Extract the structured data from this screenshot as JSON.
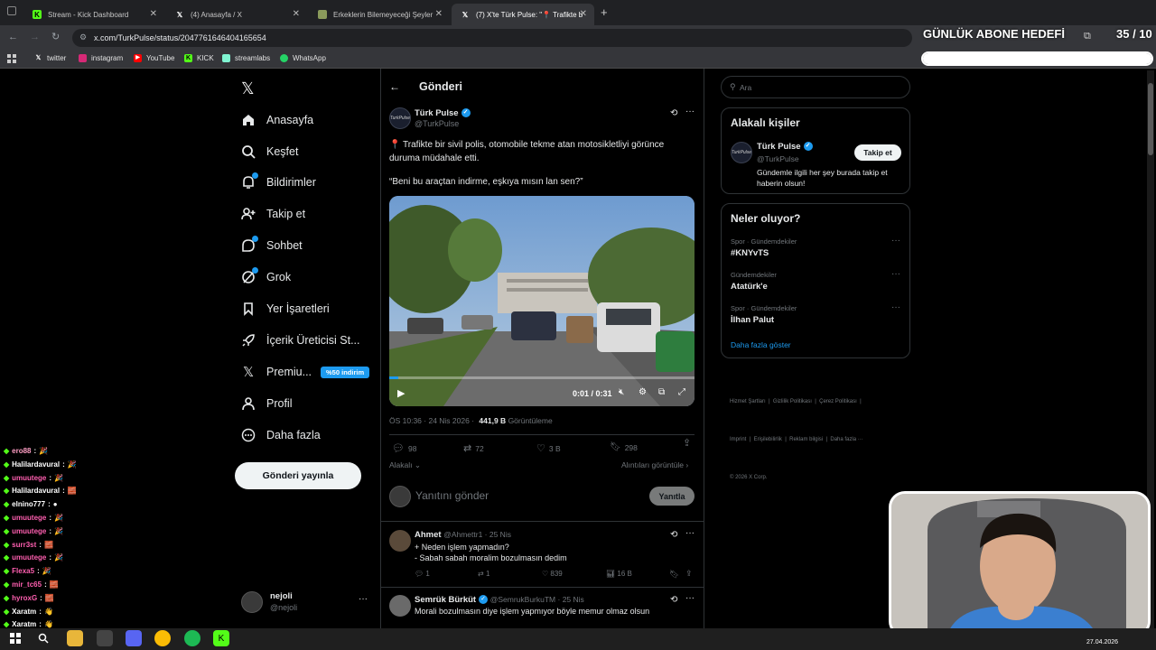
{
  "browser": {
    "tabs": [
      {
        "title": "Stream - Kick Dashboard",
        "icon": "kick-icon",
        "active": false
      },
      {
        "title": "(4) Anasayfa / X",
        "icon": "x-logo-icon",
        "active": false
      },
      {
        "title": "Erkeklerin Bilemeyeceği Şeyler",
        "icon": "generic-page-icon",
        "active": false
      },
      {
        "title": "(7) X'te Türk Pulse: \"📍 Trafikte b",
        "icon": "x-logo-icon",
        "active": true
      }
    ],
    "url": "x.com/TurkPulse/status/2047761646404165654",
    "bookmarks": [
      "twitter",
      "instagram",
      "YouTube",
      "KICK",
      "streamlabs",
      "WhatsApp"
    ]
  },
  "overlay": {
    "goal_label": "GÜNLÜK ABONE HEDEFİ",
    "goal_count": "35 / 10",
    "goal_progress": 1.0
  },
  "sidebar": {
    "items": [
      {
        "label": "Anasayfa",
        "icon": "home-icon"
      },
      {
        "label": "Keşfet",
        "icon": "search-icon"
      },
      {
        "label": "Bildirimler",
        "icon": "bell-icon"
      },
      {
        "label": "Takip et",
        "icon": "follow-icon"
      },
      {
        "label": "Sohbet",
        "icon": "chat-icon"
      },
      {
        "label": "Grok",
        "icon": "grok-icon"
      },
      {
        "label": "Yer İşaretleri",
        "icon": "bookmark-icon"
      },
      {
        "label": "İçerik Üreticisi St...",
        "icon": "rocket-icon"
      },
      {
        "label": "Premiu...",
        "icon": "x-logo-icon"
      },
      {
        "label": "Profil",
        "icon": "profile-icon"
      },
      {
        "label": "Daha fazla",
        "icon": "more-circle-icon"
      }
    ],
    "premium_badge": "%50 indirim",
    "post_button": "Gönderi yayınla",
    "account": {
      "name": "nejoli",
      "handle": "@nejoli"
    }
  },
  "main": {
    "header": "Gönderi",
    "post": {
      "author": "Türk Pulse",
      "handle": "@TurkPulse",
      "text_line1": "📍 Trafikte bir sivil polis, otomobile tekme atan motosikletliyi görünce",
      "text_line2": "duruma müdahale etti.",
      "quote": "“Beni bu araçtan indirme, eşkıya mısın lan sen?”",
      "video_time": "0:01 / 0:31",
      "video_progress": 0.03,
      "timestamp": "ÖS 10:36 · 24 Nis 2026 ·",
      "views": "441,9 B",
      "views_label": "Görüntüleme",
      "replies": "98",
      "reposts": "72",
      "likes": "3 B",
      "bookmarks": "298",
      "relevance": "Alakalı",
      "quotes_link": "Alıntıları görüntüle"
    },
    "reply_placeholder": "Yanıtını gönder",
    "reply_button": "Yanıtla",
    "replies": [
      {
        "name": "Ahmet",
        "handle": "@Ahmettr1 · 25 Nis",
        "line1": "+ Neden işlem yapmadın?",
        "line2": "- Sabah sabah moralim bozulmasın dedim",
        "replies": "1",
        "reposts": "1",
        "likes": "839",
        "views": "16 B"
      },
      {
        "name": "Semrük Bürküt",
        "handle": "@SemrukBurkuTM · 25 Nis",
        "line1": "Morali bozulmasın diye işlem yapmıyor böyle memur olmaz olsun"
      }
    ]
  },
  "right": {
    "search_placeholder": "Ara",
    "related_title": "Alakalı kişiler",
    "related": {
      "name": "Türk Pulse",
      "handle": "@TurkPulse",
      "bio1": "Gündemle ilgili her şey burada takip et",
      "bio2": "haberin olsun!",
      "follow": "Takip et"
    },
    "trends_title": "Neler oluyor?",
    "trends": [
      {
        "category": "Spor · Gündemdekiler",
        "name": "#KNYvTS"
      },
      {
        "category": "Gündemdekiler",
        "name": "Atatürk'e"
      },
      {
        "category": "Spor · Gündemdekiler",
        "name": "İlhan Palut"
      }
    ],
    "show_more": "Daha fazla göster",
    "footer_line1": "Hizmet Şartları  |  Gizlilik Politikası  |  Çerez Politikası  |",
    "footer_line2": "Imprint  |  Erişilebilirlik  |  Reklam bilgisi  |  Daha fazla ···",
    "footer_line3": "© 2026 X Corp."
  },
  "chat": [
    {
      "user": "ero88",
      "msg": "🎉",
      "color": "#ff9ec4"
    },
    {
      "user": "Halilardavural",
      "msg": "🎉",
      "color": "#ffffff"
    },
    {
      "user": "umuutege",
      "msg": "🎉",
      "color": "#ff5fb0"
    },
    {
      "user": "Halilardavural",
      "msg": "🧱",
      "color": "#ffffff"
    },
    {
      "user": "elnino777",
      "msg": "●",
      "color": "#ffffff"
    },
    {
      "user": "umuutege",
      "msg": "🎉",
      "color": "#ff5fb0"
    },
    {
      "user": "umuutege",
      "msg": "🎉",
      "color": "#ff5fb0"
    },
    {
      "user": "surr3st",
      "msg": "🧱",
      "color": "#ff5fb0"
    },
    {
      "user": "umuutege",
      "msg": "🎉",
      "color": "#ff5fb0"
    },
    {
      "user": "Flexa5",
      "msg": "🎉",
      "color": "#ff5fb0"
    },
    {
      "user": "mir_tc65",
      "msg": "🧱",
      "color": "#ff5fb0"
    },
    {
      "user": "hyroxG",
      "msg": "🧱",
      "color": "#ff5fb0"
    },
    {
      "user": "Xaratm",
      "msg": "👋",
      "color": "#ffffff"
    },
    {
      "user": "Xaratm",
      "msg": "👋",
      "color": "#ffffff"
    }
  ],
  "taskbar": {
    "date": "27.04.2026"
  },
  "colors": {
    "accent": "#1d9bf0",
    "kick": "#53fc18",
    "premium": "#1d9bf0"
  }
}
